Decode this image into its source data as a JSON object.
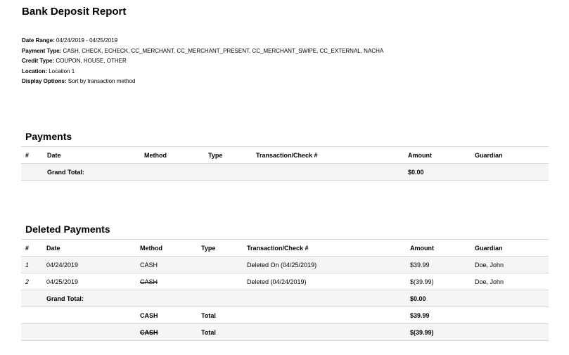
{
  "report": {
    "title": "Bank Deposit Report",
    "filters": [
      {
        "label": "Date Range:",
        "value": "04/24/2019 - 04/25/2019"
      },
      {
        "label": "Payment Type:",
        "value": "CASH, CHECK, ECHECK, CC_MERCHANT, CC_MERCHANT_PRESENT, CC_MERCHANT_SWIPE, CC_EXTERNAL, NACHA"
      },
      {
        "label": "Credit Type:",
        "value": "COUPON, HOUSE, OTHER"
      },
      {
        "label": "Location:",
        "value": "Location 1"
      },
      {
        "label": "Display Options:",
        "value": "Sort by transaction method"
      }
    ]
  },
  "payments": {
    "title": "Payments",
    "columns": [
      "#",
      "Date",
      "Method",
      "Type",
      "Transaction/Check #",
      "Amount",
      "Guardian"
    ],
    "grand_total_label": "Grand Total:",
    "grand_total_amount": "$0.00"
  },
  "deleted_payments": {
    "title": "Deleted Payments",
    "columns": [
      "#",
      "Date",
      "Method",
      "Type",
      "Transaction/Check #",
      "Amount",
      "Guardian"
    ],
    "rows": [
      {
        "num": "1",
        "date": "04/24/2019",
        "method": "CASH",
        "type": "",
        "transaction": "Deleted On (04/25/2019)",
        "amount": "$39.99",
        "guardian": "Doe, John"
      },
      {
        "num": "2",
        "date": "04/25/2019",
        "method": "CASH",
        "type": "",
        "transaction": "Deleted (04/24/2019)",
        "amount": "$(39.99)",
        "guardian": "Doe, John"
      }
    ],
    "grand_total_label": "Grand Total:",
    "grand_total_amount": "$0.00",
    "method_totals": [
      {
        "method": "CASH",
        "label": "Total",
        "amount": "$39.99"
      },
      {
        "method": "CASH",
        "label": "Total",
        "amount": "$(39.99)"
      }
    ]
  }
}
